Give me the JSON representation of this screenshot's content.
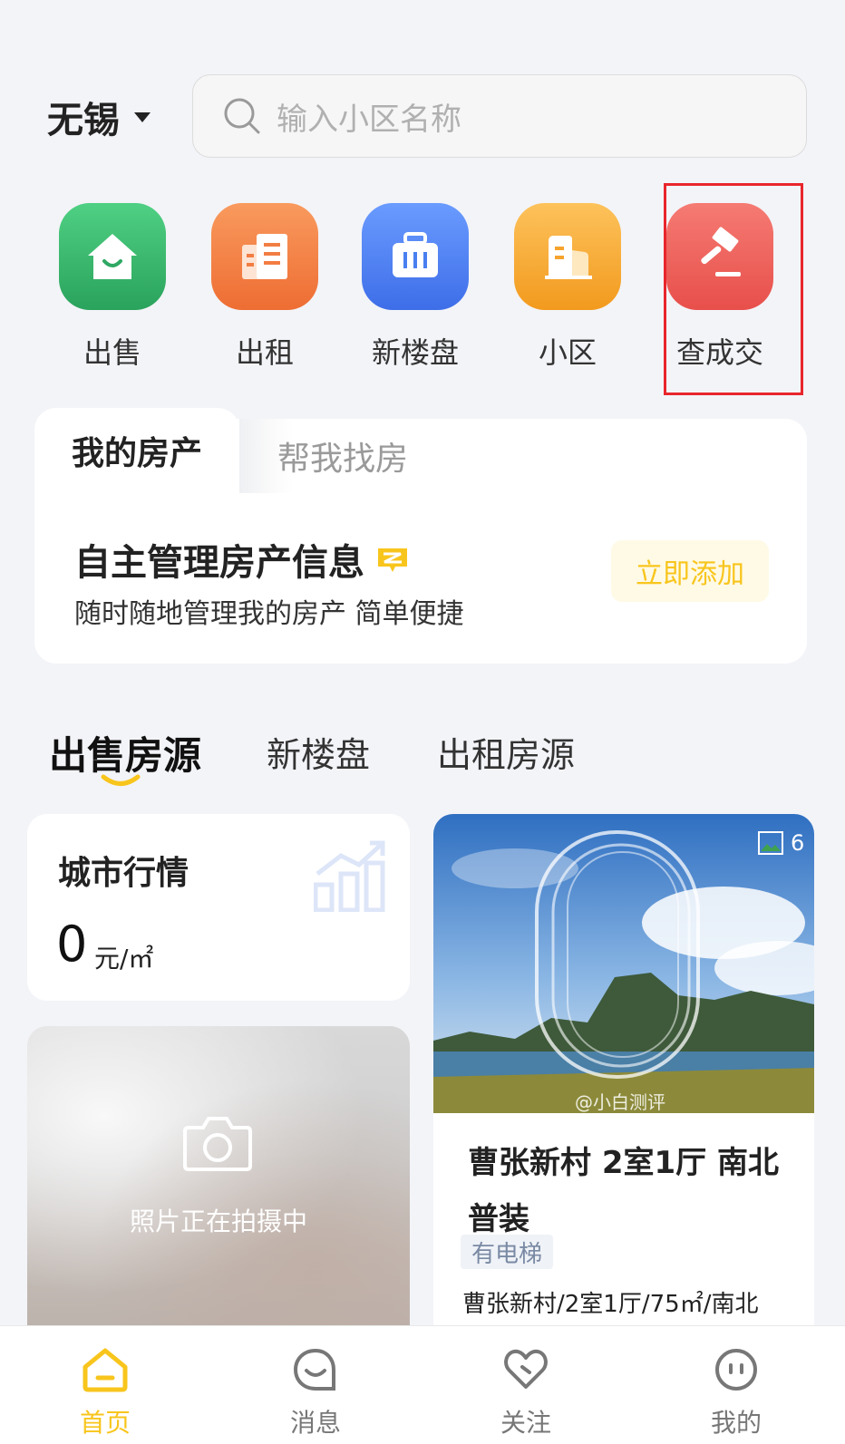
{
  "header": {
    "city": "无锡",
    "search_placeholder": "输入小区名称"
  },
  "quick_entries": [
    {
      "label": "出售",
      "icon": "house-icon",
      "color": "#3dbb6e"
    },
    {
      "label": "出租",
      "icon": "rental-doc-icon",
      "color": "#f27d43"
    },
    {
      "label": "新楼盘",
      "icon": "new-building-icon",
      "color": "#4a7ff0"
    },
    {
      "label": "小区",
      "icon": "community-building-icon",
      "color": "#f6a32d"
    },
    {
      "label": "查成交",
      "icon": "gavel-icon",
      "color": "#ec5a55"
    }
  ],
  "property_card": {
    "tab_active": "我的房产",
    "tab_inactive": "帮我找房",
    "title": "自主管理房产信息",
    "subtitle": "随时随地管理我的房产 简单便捷",
    "action": "立即添加"
  },
  "section_tabs": [
    "出售房源",
    "新楼盘",
    "出租房源"
  ],
  "market": {
    "title": "城市行情",
    "value": "0",
    "unit": "元/㎡"
  },
  "photo_card": {
    "text": "照片正在拍摄中"
  },
  "listing": {
    "image_count": "6",
    "title": " 曹张新村 2室1厅 南北普装",
    "tag": "有电梯",
    "desc": "曹张新村/2室1厅/75㎡/南北",
    "watermark": "@小白测评"
  },
  "bottom_nav": [
    {
      "label": "首页",
      "icon": "home-icon",
      "active": true
    },
    {
      "label": "消息",
      "icon": "message-icon",
      "active": false
    },
    {
      "label": "关注",
      "icon": "heart-icon",
      "active": false
    },
    {
      "label": "我的",
      "icon": "profile-icon",
      "active": false
    }
  ],
  "colors": {
    "accent": "#f8c51c",
    "highlight": "#e8262c"
  }
}
